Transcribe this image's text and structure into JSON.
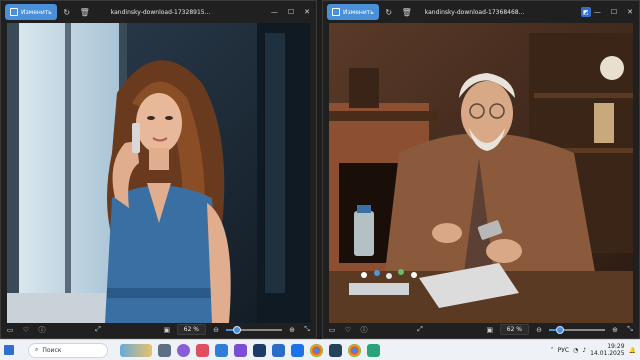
{
  "left_window": {
    "edit_label": "Изменить",
    "filename": "kandinsky-download-17328915...",
    "zoom": "62 %",
    "zoom_fraction": 0.2
  },
  "right_window": {
    "edit_label": "Изменить",
    "filename": "kandinsky-download-17368468...",
    "zoom": "62 %",
    "zoom_fraction": 0.2
  },
  "taskbar": {
    "search_placeholder": "Поиск",
    "tray_lang": "РУС",
    "time": "19:29",
    "date": "14.01.2025"
  },
  "colors": {
    "accent": "#4a90d9",
    "window_bg": "#202020",
    "taskbar_bg": "#eef2f6"
  }
}
